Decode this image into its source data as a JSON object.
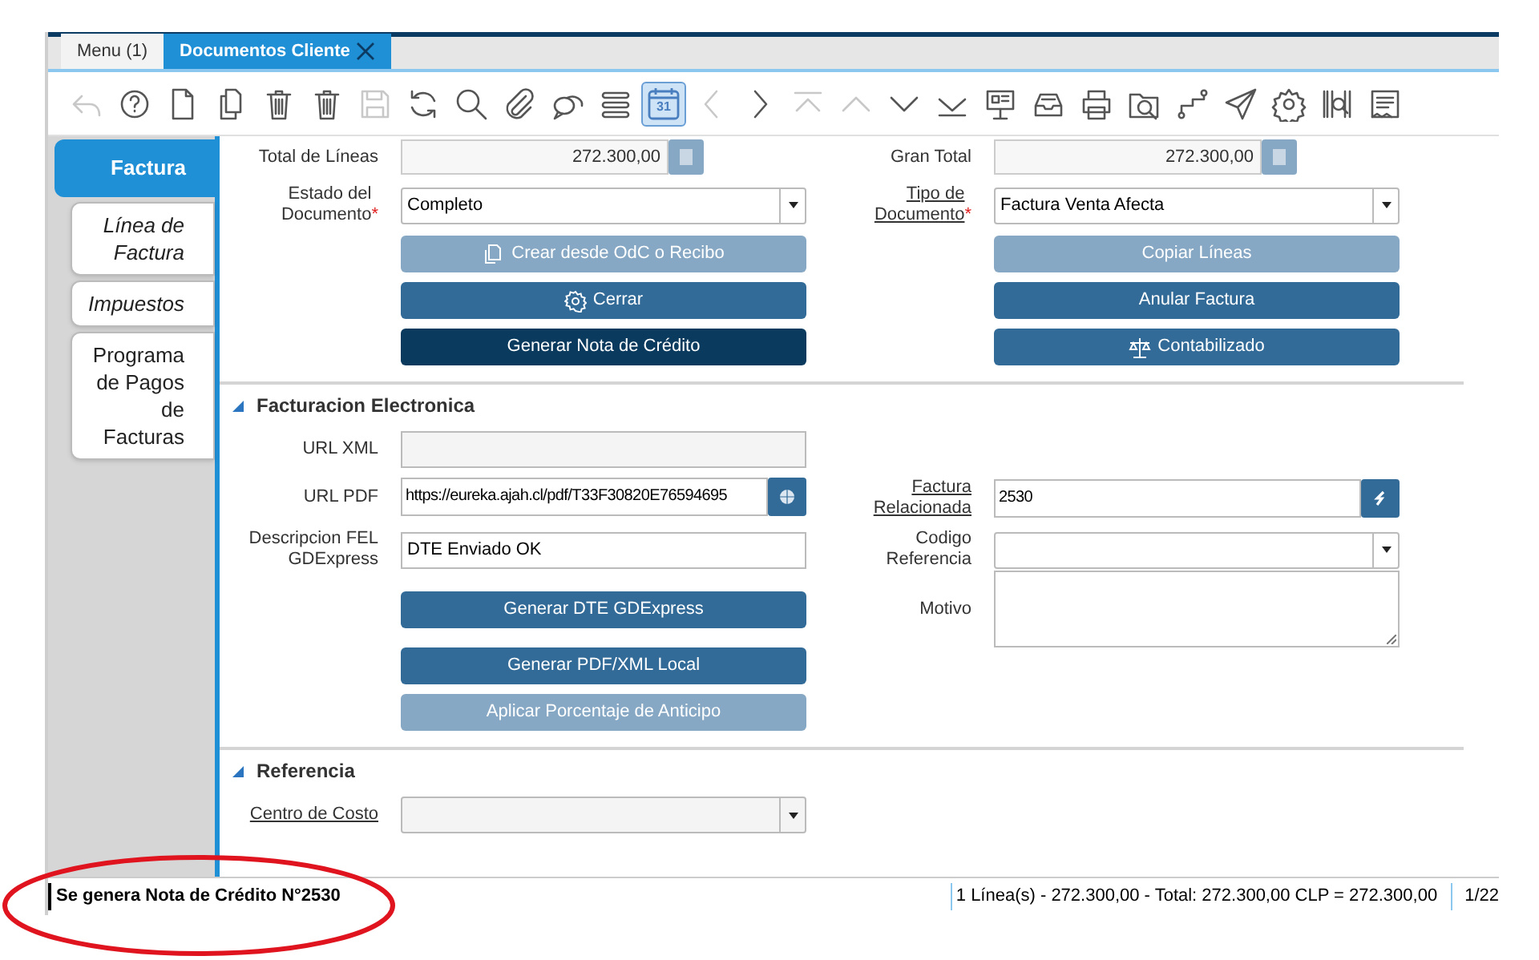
{
  "window_tabs": [
    {
      "label": "Menu (1)",
      "selected": false,
      "closable": false
    },
    {
      "label": "Documentos Cliente",
      "selected": true,
      "closable": true
    }
  ],
  "toolbar": [
    {
      "kind": "undo",
      "disabled": true,
      "selected": false
    },
    {
      "kind": "help",
      "disabled": false,
      "selected": false
    },
    {
      "kind": "new",
      "disabled": false,
      "selected": false
    },
    {
      "kind": "copy",
      "disabled": false,
      "selected": false
    },
    {
      "kind": "delete",
      "disabled": false,
      "selected": false
    },
    {
      "kind": "delete-selection",
      "disabled": false,
      "selected": false
    },
    {
      "kind": "save",
      "disabled": true,
      "selected": false
    },
    {
      "kind": "refresh",
      "disabled": false,
      "selected": false
    },
    {
      "kind": "search",
      "disabled": false,
      "selected": false
    },
    {
      "kind": "attach",
      "disabled": false,
      "selected": false
    },
    {
      "kind": "chat",
      "disabled": false,
      "selected": false
    },
    {
      "kind": "list",
      "disabled": false,
      "selected": false
    },
    {
      "kind": "calendar",
      "disabled": false,
      "selected": true,
      "label": "31"
    },
    {
      "kind": "previous",
      "disabled": true,
      "selected": false
    },
    {
      "kind": "next",
      "disabled": false,
      "selected": false
    },
    {
      "kind": "first",
      "disabled": true,
      "selected": false
    },
    {
      "kind": "up",
      "disabled": true,
      "selected": false
    },
    {
      "kind": "down",
      "disabled": false,
      "selected": false
    },
    {
      "kind": "last",
      "disabled": false,
      "selected": false
    },
    {
      "kind": "report",
      "disabled": false,
      "selected": false
    },
    {
      "kind": "archive",
      "disabled": false,
      "selected": false
    },
    {
      "kind": "print",
      "disabled": false,
      "selected": false
    },
    {
      "kind": "zoom-folder",
      "disabled": false,
      "selected": false
    },
    {
      "kind": "workflow",
      "disabled": false,
      "selected": false
    },
    {
      "kind": "send",
      "disabled": false,
      "selected": false
    },
    {
      "kind": "settings",
      "disabled": false,
      "selected": false
    },
    {
      "kind": "barcode",
      "disabled": false,
      "selected": false
    },
    {
      "kind": "form",
      "disabled": false,
      "selected": false
    }
  ],
  "sidebar": {
    "items": [
      {
        "label": "Factura",
        "selected": true,
        "italic": false
      },
      {
        "label": "Línea de Factura",
        "selected": false,
        "italic": true
      },
      {
        "label": "Impuestos",
        "selected": false,
        "italic": true
      },
      {
        "label": "Programa de Pagos de Facturas",
        "selected": false,
        "italic": false
      }
    ]
  },
  "sections": [
    {
      "rows": [
        {
          "left": {
            "kind": "amount",
            "label": "Total de Líneas",
            "value": "272.300,00",
            "link": false
          },
          "right": {
            "kind": "amount",
            "label": "Gran Total",
            "value": "272.300,00",
            "link": false
          }
        },
        {
          "left": {
            "kind": "select",
            "label": "Estado del Documento",
            "required_mark": "*",
            "value": "Completo",
            "link": false
          },
          "right": {
            "kind": "select",
            "label": "Tipo de Documento",
            "required_mark": "*",
            "value": "Factura Venta Afecta",
            "link": true
          }
        },
        {
          "left": {
            "kind": "copy-button",
            "label": "Crear desde OdC o Recibo",
            "disabled": true,
            "focused": false
          },
          "right": {
            "kind": "button",
            "label": "Copiar Líneas",
            "disabled": true,
            "focused": false
          }
        },
        {
          "left": {
            "kind": "gear-button",
            "label": "Cerrar",
            "disabled": false,
            "focused": false
          },
          "right": {
            "kind": "button",
            "label": "Anular Factura",
            "disabled": false,
            "focused": false
          }
        },
        {
          "left": {
            "kind": "button",
            "label": "Generar Nota de Crédito",
            "disabled": false,
            "focused": true
          },
          "right": {
            "kind": "scale-button",
            "label": "Contabilizado",
            "disabled": false,
            "focused": false
          }
        }
      ]
    },
    {
      "title": "Facturacion Electronica",
      "expanded": true,
      "rows": [
        {
          "left": {
            "kind": "text",
            "label": "URL XML",
            "disabled": true,
            "link": false
          }
        },
        {
          "left": {
            "kind": "url",
            "label": "URL PDF",
            "value": "https://eureka.ajah.cl/pdf/T33F30820E76594695",
            "link": false
          },
          "right": {
            "kind": "search",
            "label": "Factura Relacionada",
            "value": "2530",
            "link": true
          }
        },
        {
          "left": {
            "kind": "text",
            "label": "Descripcion FEL GDExpress",
            "value": "DTE Enviado OK",
            "disabled": false,
            "link": false
          },
          "right": {
            "kind": "select",
            "label": "Codigo Referencia",
            "link": false
          }
        },
        {
          "left": {
            "kind": "button",
            "label": "Generar DTE GDExpress",
            "disabled": false,
            "focused": false
          },
          "right": {
            "kind": "textarea",
            "label": "Motivo",
            "link": false
          }
        },
        {
          "left": {
            "kind": "button",
            "label": "Generar PDF/XML Local",
            "disabled": false,
            "focused": false
          }
        },
        {
          "left": {
            "kind": "button",
            "label": "Aplicar Porcentaje de Anticipo",
            "disabled": true,
            "focused": false
          }
        }
      ]
    },
    {
      "title": "Referencia",
      "expanded": true,
      "rows": [
        {
          "left": {
            "kind": "select",
            "label": "Centro de Costo",
            "link": true,
            "disabled": true
          }
        }
      ]
    }
  ],
  "status_bar": {
    "message": "Se genera Nota de Crédito N°2530",
    "summary": "1 Línea(s) - 272.300,00 - Total: 272.300,00 CLP = 272.300,00",
    "page": "1/22"
  },
  "annotations": [
    {
      "kind": "ellipse"
    }
  ]
}
